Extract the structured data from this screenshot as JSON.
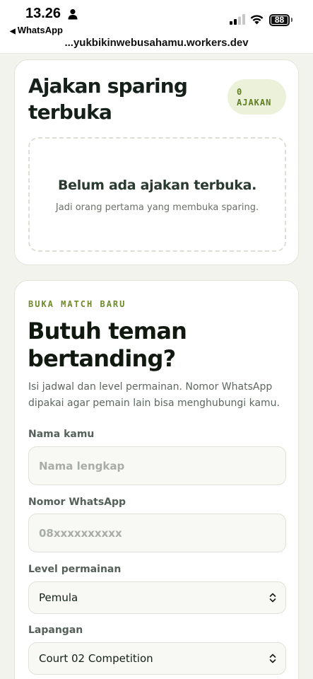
{
  "status_bar": {
    "time": "13.26",
    "back_app": "WhatsApp",
    "url": "...yukbikinwebusahamu.workers.dev",
    "battery": "88"
  },
  "open_invites": {
    "title": "Ajakan sparing terbuka",
    "count": "0",
    "count_unit": "AJAKAN",
    "empty_title": "Belum ada ajakan terbuka.",
    "empty_subtitle": "Jadi orang pertama yang membuka sparing."
  },
  "new_match": {
    "eyebrow": "BUKA MATCH BARU",
    "title": "Butuh teman bertanding?",
    "description": "Isi jadwal dan level permainan. Nomor WhatsApp dipakai agar pemain lain bisa menghubungi kamu.",
    "fields": {
      "name": {
        "label": "Nama kamu",
        "placeholder": "Nama lengkap",
        "value": ""
      },
      "whatsapp": {
        "label": "Nomor WhatsApp",
        "placeholder": "08xxxxxxxxxx",
        "value": ""
      },
      "level": {
        "label": "Level permainan",
        "selected": "Pemula"
      },
      "court": {
        "label": "Lapangan",
        "selected": "Court 02 Competition"
      }
    }
  }
}
